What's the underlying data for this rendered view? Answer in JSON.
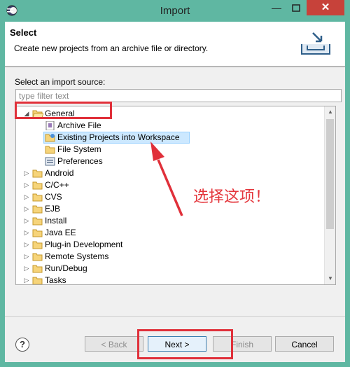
{
  "window": {
    "title": "Import"
  },
  "header": {
    "title": "Select",
    "description": "Create new projects from an archive file or directory."
  },
  "source": {
    "label": "Select an import source:",
    "filter_placeholder": "type filter text",
    "filter_value": ""
  },
  "tree": {
    "general": {
      "label": "General",
      "children": [
        "Archive File",
        "Existing Projects into Workspace",
        "File System",
        "Preferences"
      ]
    },
    "categories": [
      "Android",
      "C/C++",
      "CVS",
      "EJB",
      "Install",
      "Java EE",
      "Plug-in Development",
      "Remote Systems",
      "Run/Debug",
      "Tasks"
    ]
  },
  "annotation": {
    "text": "选择这项！"
  },
  "buttons": {
    "help": "?",
    "back": "< Back",
    "next": "Next >",
    "finish": "Finish",
    "cancel": "Cancel"
  },
  "colors": {
    "frame": "#5fb7a2",
    "close": "#c7423a",
    "annotation": "#e0303a",
    "selection": "#cce8ff"
  }
}
